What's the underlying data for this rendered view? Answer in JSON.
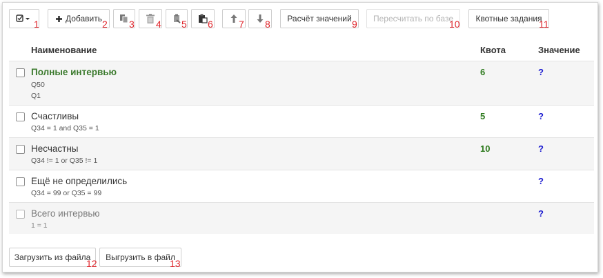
{
  "toolbar": {
    "add_label": "Добавить",
    "calc_label": "Расчёт значений",
    "recalc_label": "Пересчитать по базе",
    "quota_tasks_label": "Квотные задания",
    "numbers": [
      "1",
      "2",
      "3",
      "4",
      "5",
      "6",
      "7",
      "8",
      "9",
      "10",
      "11"
    ]
  },
  "table": {
    "headers": {
      "name": "Наименование",
      "quota": "Квота",
      "value": "Значение"
    },
    "rows": [
      {
        "name": "Полные интервью",
        "subs": [
          "Q50",
          "Q1"
        ],
        "quota": "6",
        "value": "?"
      },
      {
        "name": "Счастливы",
        "subs": [
          "Q34 = 1 and Q35 = 1"
        ],
        "quota": "5",
        "value": "?"
      },
      {
        "name": "Несчастны",
        "subs": [
          "Q34 != 1 or Q35 != 1"
        ],
        "quota": "10",
        "value": "?"
      },
      {
        "name": "Ещё не определились",
        "subs": [
          "Q34 = 99 or Q35 = 99"
        ],
        "quota": "",
        "value": "?"
      },
      {
        "name": "Всего интервью",
        "subs": [
          "1 = 1"
        ],
        "quota": "",
        "value": "?"
      }
    ]
  },
  "footer": {
    "load_label": "Загрузить из файла",
    "export_label": "Выгрузить в файл",
    "numbers": [
      "12",
      "13"
    ]
  },
  "colors": {
    "accent_number": "#e0252b",
    "quota_green": "#2e7a1e",
    "value_blue": "#1a1ad0"
  }
}
